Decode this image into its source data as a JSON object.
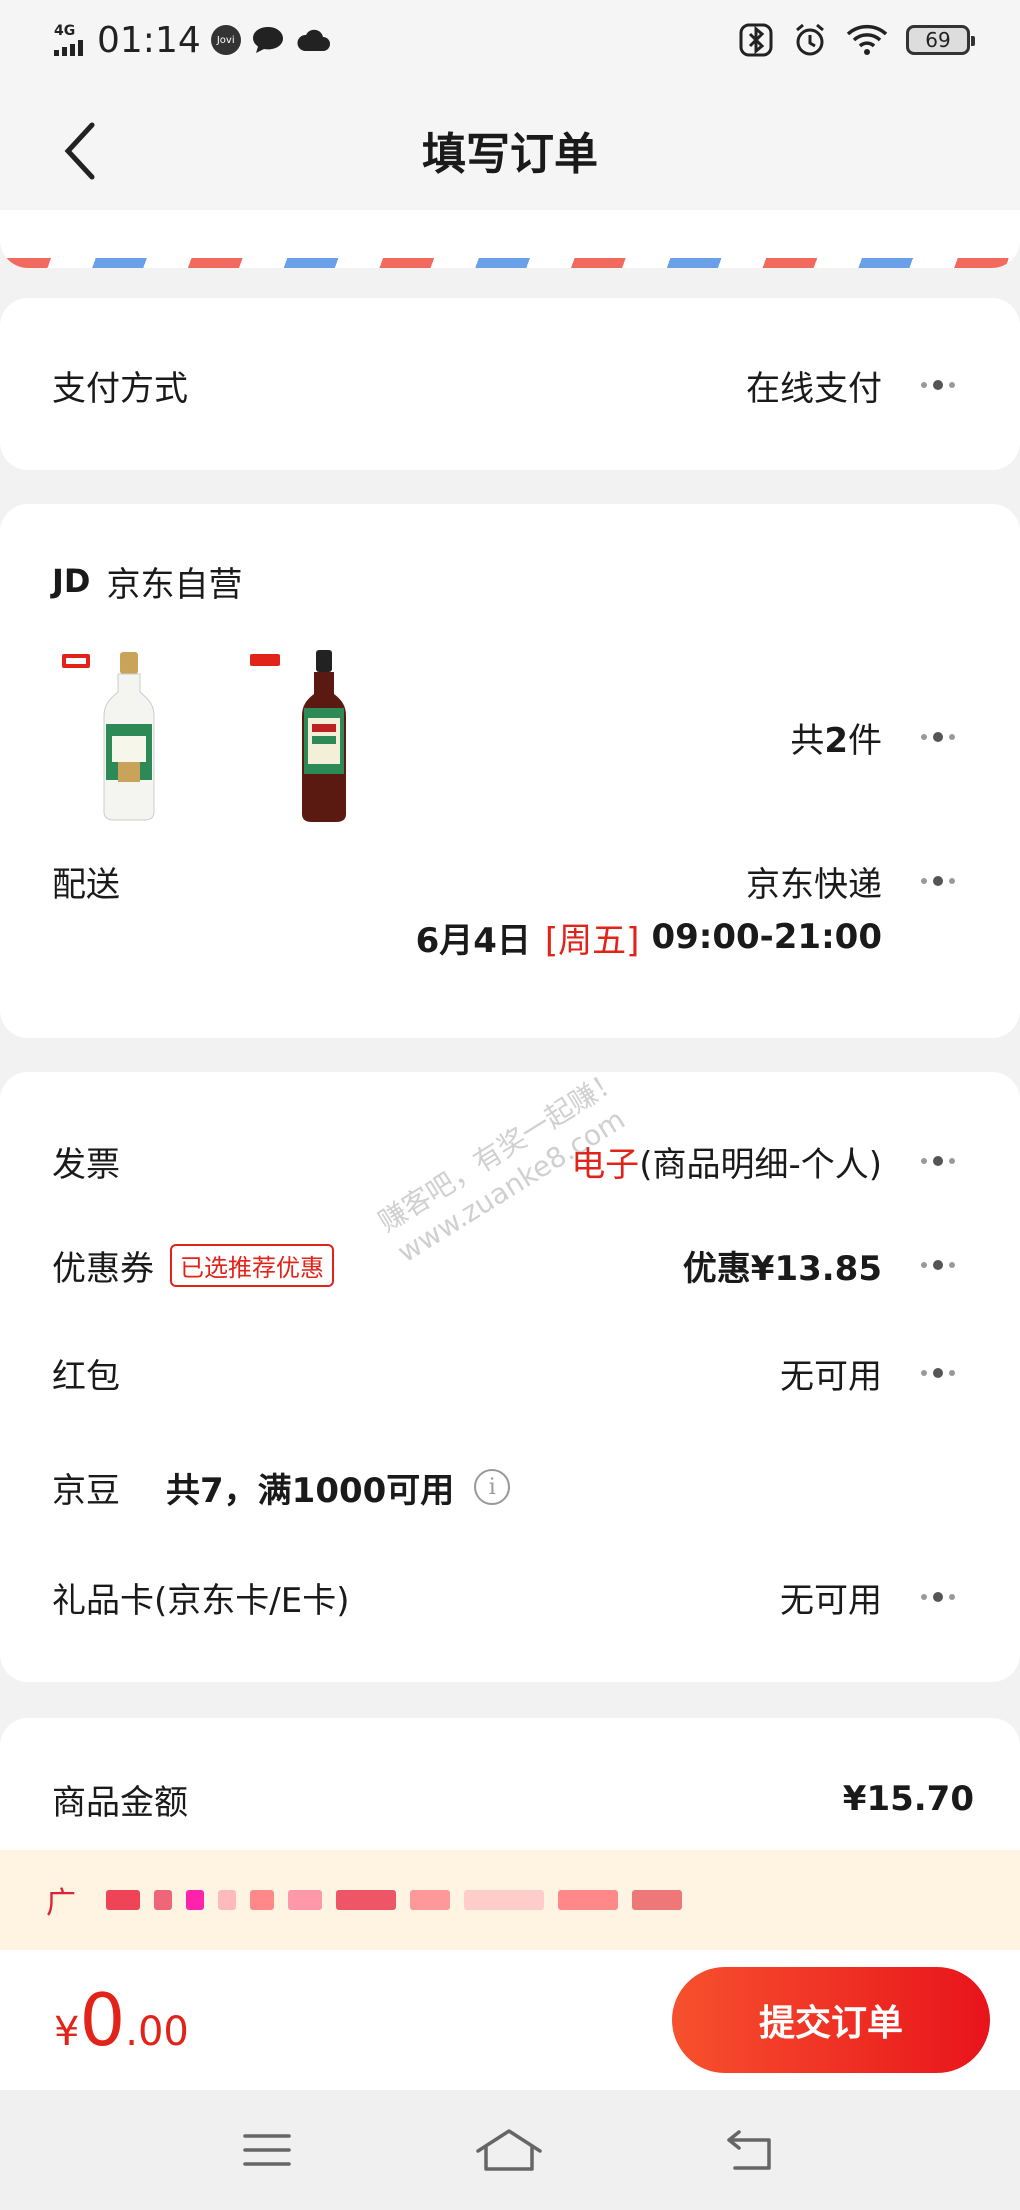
{
  "status_bar": {
    "network": "4G",
    "time": "01:14",
    "app_badge": "Jovi",
    "battery": "69"
  },
  "header": {
    "title": "填写订单"
  },
  "payment": {
    "label": "支付方式",
    "value": "在线支付"
  },
  "shop": {
    "logo": "JD",
    "name": "京东自营",
    "products": [
      {
        "icon": "vinegar-bottle",
        "brand_color": "#e2231a"
      },
      {
        "icon": "cooking-wine-bottle",
        "brand_color": "#e2231a"
      }
    ],
    "count_prefix": "共",
    "count": "2",
    "count_suffix": "件",
    "delivery_label": "配送",
    "delivery_method": "京东快递",
    "delivery_date": "6月4日",
    "delivery_weekday": "[周五]",
    "delivery_time": "09:00-21:00"
  },
  "options": {
    "invoice_label": "发票",
    "invoice_type": "电子",
    "invoice_detail": "(商品明细-个人)",
    "coupon_label": "优惠券",
    "coupon_tag": "已选推荐优惠",
    "coupon_value": "优惠¥13.85",
    "redpacket_label": "红包",
    "redpacket_value": "无可用",
    "jingdou_label": "京豆",
    "jingdou_value": "共7，满1000可用",
    "giftcard_label": "礼品卡(京东卡/E卡)",
    "giftcard_value": "无可用"
  },
  "summary": {
    "goods_amount_label": "商品金额",
    "goods_amount_value": "¥15.70"
  },
  "ad": {
    "label": "广"
  },
  "watermark": {
    "line1": "赚客吧，有奖一起赚！",
    "line2": "www.zuanke8.com"
  },
  "bottom": {
    "currency": "¥",
    "total_int": "0",
    "total_dec": ".00",
    "submit_label": "提交订单"
  },
  "colors": {
    "accent": "#e2231a",
    "button_start": "#f7512e",
    "button_end": "#e8141b"
  }
}
